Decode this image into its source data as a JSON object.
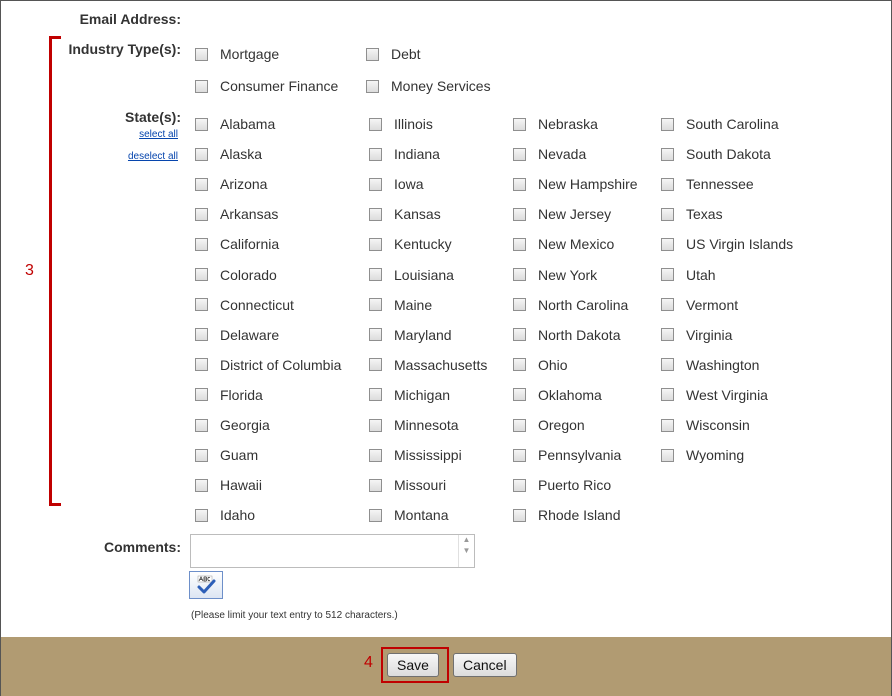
{
  "form": {
    "email_label": "Email Address:",
    "industry_label": "Industry Type(s):",
    "industry_types": [
      "Mortgage",
      "Debt",
      "Consumer Finance",
      "Money Services"
    ],
    "states_label": "State(s):",
    "select_all": "select all",
    "deselect_all": "deselect all",
    "states_col1": [
      "Alabama",
      "Alaska",
      "Arizona",
      "Arkansas",
      "California",
      "Colorado",
      "Connecticut",
      "Delaware",
      "District of Columbia",
      "Florida",
      "Georgia",
      "Guam",
      "Hawaii",
      "Idaho"
    ],
    "states_col2": [
      "Illinois",
      "Indiana",
      "Iowa",
      "Kansas",
      "Kentucky",
      "Louisiana",
      "Maine",
      "Maryland",
      "Massachusetts",
      "Michigan",
      "Minnesota",
      "Mississippi",
      "Missouri",
      "Montana"
    ],
    "states_col3": [
      "Nebraska",
      "Nevada",
      "New Hampshire",
      "New Jersey",
      "New Mexico",
      "New York",
      "North Carolina",
      "North Dakota",
      "Ohio",
      "Oklahoma",
      "Oregon",
      "Pennsylvania",
      "Puerto Rico",
      "Rhode Island"
    ],
    "states_col4": [
      "South Carolina",
      "South Dakota",
      "Tennessee",
      "Texas",
      "US Virgin Islands",
      "Utah",
      "Vermont",
      "Virginia",
      "Washington",
      "West Virginia",
      "Wisconsin",
      "Wyoming"
    ],
    "comments_label": "Comments:",
    "comments_value": "",
    "spellcheck_icon": "spellcheck-icon",
    "char_limit_hint": "(Please limit your text entry to 512 characters.)"
  },
  "footer": {
    "save_label": "Save",
    "cancel_label": "Cancel"
  },
  "annotations": {
    "step3": "3",
    "step4": "4",
    "color": "#c00000"
  },
  "colors": {
    "footer_bg": "#b19b72",
    "link": "#0645ad"
  }
}
